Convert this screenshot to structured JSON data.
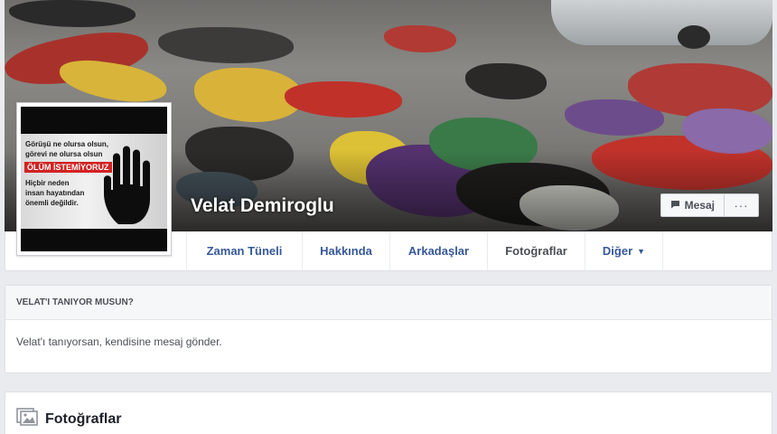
{
  "profile": {
    "name": "Velat Demiroglu"
  },
  "profile_picture": {
    "lines_top": [
      "Görüşü ne olursa olsun,",
      "görevi ne olursa olsun"
    ],
    "banner": "ÖLÜM İSTEMİYORUZ",
    "lines_bottom": [
      "Hiçbir neden",
      "insan hayatından",
      "önemli değildir."
    ]
  },
  "cover_actions": {
    "message_label": "Mesaj",
    "more_label": "···"
  },
  "nav": {
    "tabs": [
      {
        "label": "Zaman Tüneli"
      },
      {
        "label": "Hakkında"
      },
      {
        "label": "Arkadaşlar"
      },
      {
        "label": "Fotoğraflar"
      },
      {
        "label": "Diğer"
      }
    ]
  },
  "know_card": {
    "header": "VELAT'I TANIYOR MUSUN?",
    "body": "Velat'ı tanıyorsan, kendisine mesaj gönder."
  },
  "photos_card": {
    "title": "Fotoğraflar"
  }
}
